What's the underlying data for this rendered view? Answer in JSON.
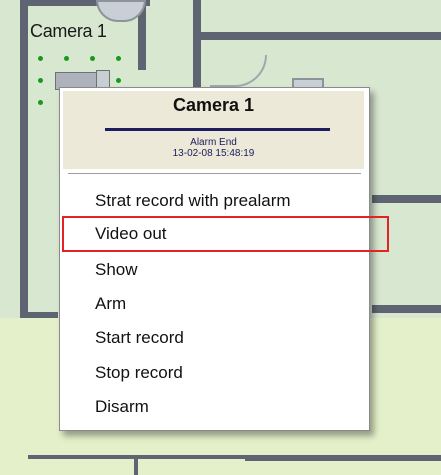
{
  "camera_label": "Camera 1",
  "menu": {
    "title": "Camera 1",
    "event_name": "Alarm End",
    "event_time": "13-02-08 15:48:19",
    "items": [
      {
        "label": "Strat record with prealarm"
      },
      {
        "label": "Video out"
      },
      {
        "label": "Show"
      },
      {
        "label": "Arm"
      },
      {
        "label": "Start record"
      },
      {
        "label": "Stop record"
      },
      {
        "label": "Disarm"
      }
    ],
    "highlighted_item": "Video out"
  },
  "colors": {
    "highlight_border": "#e32225",
    "menu_header_bg": "#ece9d8",
    "title_underline": "#1c1c5e",
    "camera_dot": "#159a1b"
  },
  "icons": [
    "camera-icon"
  ]
}
